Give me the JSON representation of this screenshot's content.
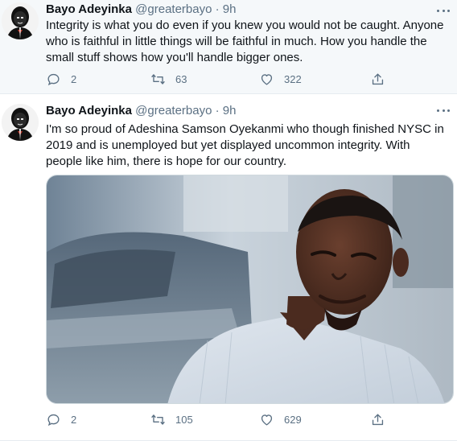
{
  "tweets": [
    {
      "author_name": "Bayo Adeyinka",
      "handle": "@greaterbayo",
      "separator": "·",
      "time": "9h",
      "text": "Integrity is what you do even if you knew you would not be caught. Anyone who is faithful in little things will be faithful in much. How you handle the small stuff shows how you'll handle bigger ones.",
      "replies": "2",
      "retweets": "63",
      "likes": "322"
    },
    {
      "author_name": "Bayo Adeyinka",
      "handle": "@greaterbayo",
      "separator": "·",
      "time": "9h",
      "text": "I'm so proud of Adeshina Samson Oyekanmi who though finished NYSC in 2019 and is unemployed but yet displayed uncommon integrity. With people like him, there is hope for our country.",
      "replies": "2",
      "retweets": "105",
      "likes": "629"
    }
  ],
  "icons": {
    "reply": "reply-icon",
    "retweet": "retweet-icon",
    "like": "heart-icon",
    "share": "share-icon",
    "more": "more-icon"
  },
  "colors": {
    "text": "#0f1419",
    "muted": "#5b7083",
    "highlight_background": "#f5f8fa",
    "border": "#e6ecf0"
  }
}
